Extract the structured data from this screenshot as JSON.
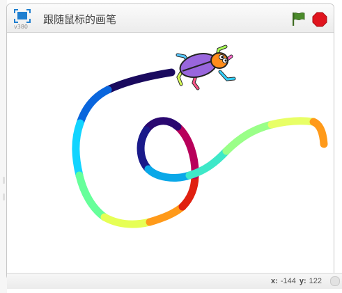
{
  "stage": {
    "version": "v380",
    "title": "跟随鼠标的画笔",
    "icons": {
      "presentation": "fullscreen-presentation-icon",
      "green_flag": "green-flag-icon",
      "stop": "stop-sign-icon",
      "sprite": "beetle-sprite"
    },
    "colors": {
      "presentation_blue": "#1f7fd0",
      "flag_green": "#4a7a2a",
      "stop_red": "#e0141e",
      "beetle_body": "#9966dd",
      "beetle_head": "#ff8c1a"
    }
  },
  "pen_trail": {
    "description_colors": [
      "#1a0a5e",
      "#0a66dd",
      "#12d4ff",
      "#66ff9a",
      "#e6ff55",
      "#ff9a1a",
      "#e02010",
      "#b8005a",
      "#2a0870"
    ]
  },
  "status": {
    "x_label": "x:",
    "x_value": "-144",
    "y_label": "y:",
    "y_value": "122"
  }
}
